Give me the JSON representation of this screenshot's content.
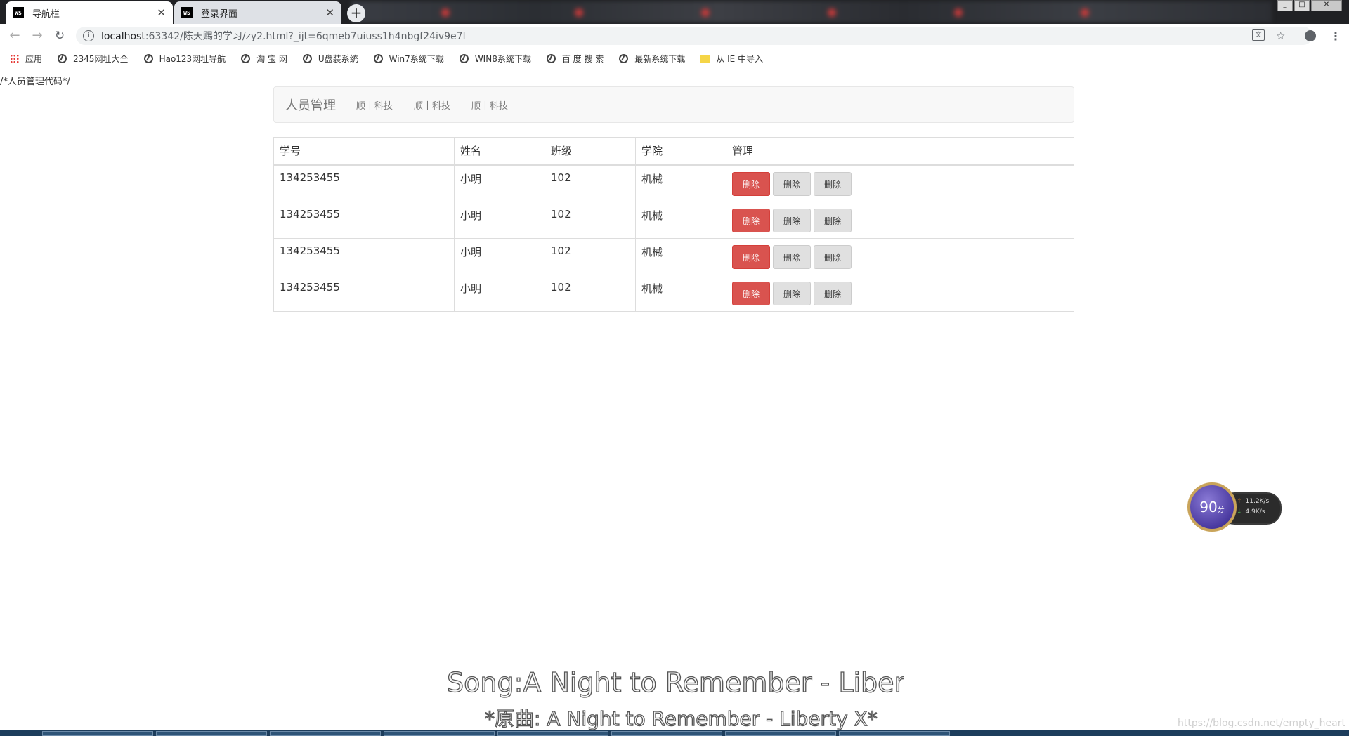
{
  "browser": {
    "tabs": [
      {
        "label": "导航栏",
        "icon": "ws-icon",
        "active": true
      },
      {
        "label": "登录界面",
        "icon": "ws-icon",
        "active": false
      }
    ],
    "url_host": "localhost",
    "url_rest": ":63342/陈天赐的学习/zy2.html?_ijt=6qmeb7uiuss1h4nbgf24iv9e7l",
    "bookmarks": [
      {
        "label": "应用",
        "icon": "apps-grid-icon"
      },
      {
        "label": "2345网址大全",
        "icon": "globe-icon"
      },
      {
        "label": "Hao123网址导航",
        "icon": "globe-icon"
      },
      {
        "label": "淘 宝 网",
        "icon": "globe-icon"
      },
      {
        "label": "U盘装系统",
        "icon": "globe-icon"
      },
      {
        "label": "Win7系统下载",
        "icon": "globe-icon"
      },
      {
        "label": "WIN8系统下载",
        "icon": "globe-icon"
      },
      {
        "label": "百 度 搜 索",
        "icon": "globe-icon"
      },
      {
        "label": "最新系统下载",
        "icon": "globe-icon"
      },
      {
        "label": "从 IE 中导入",
        "icon": "folder-icon"
      }
    ]
  },
  "page": {
    "comment": "/*人员管理代码*/",
    "navbar": {
      "brand": "人员管理",
      "links": [
        "顺丰科技",
        "顺丰科技",
        "顺丰科技"
      ]
    },
    "table": {
      "headers": [
        "学号",
        "姓名",
        "班级",
        "学院",
        "管理"
      ],
      "rows": [
        {
          "id": "134253455",
          "name": "小明",
          "class": "102",
          "college": "机械"
        },
        {
          "id": "134253455",
          "name": "小明",
          "class": "102",
          "college": "机械"
        },
        {
          "id": "134253455",
          "name": "小明",
          "class": "102",
          "college": "机械"
        },
        {
          "id": "134253455",
          "name": "小明",
          "class": "102",
          "college": "机械"
        }
      ],
      "button_label": "删除"
    }
  },
  "speed_widget": {
    "score": "90",
    "unit": "分",
    "upload": "11.2K/s",
    "download": "4.9K/s"
  },
  "overlay": {
    "lyric_line1": "Song:A Night to Remember - Liberty X*",
    "lyric_line2": "*原曲: A Night to Remember - Liberty X*",
    "watermark": "https://blog.csdn.net/empty_heart"
  },
  "colors": {
    "danger": "#d9534f",
    "default_btn": "#e0e0e0",
    "navbar_bg": "#f8f8f8"
  }
}
